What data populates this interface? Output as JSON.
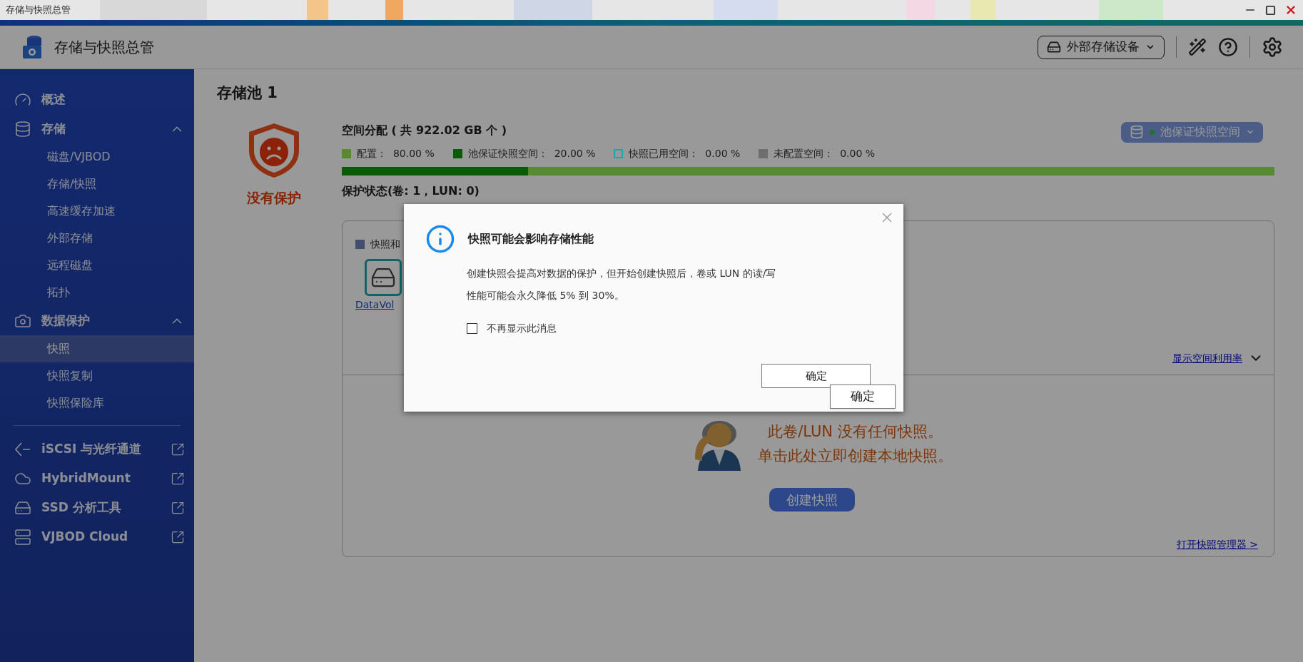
{
  "window": {
    "title": "存储与快照总管"
  },
  "header": {
    "app_title": "存储与快照总管",
    "device_button": "外部存储设备"
  },
  "sidebar": {
    "items": [
      {
        "kind": "link",
        "label": "概述"
      },
      {
        "kind": "group",
        "label": "存储",
        "expanded": true,
        "children": [
          {
            "label": "磁盘/VJBOD",
            "selected": false
          },
          {
            "label": "存储/快照",
            "selected": false
          },
          {
            "label": "高速缓存加速",
            "selected": false
          },
          {
            "label": "外部存储",
            "selected": false
          },
          {
            "label": "远程磁盘",
            "selected": false
          },
          {
            "label": "拓扑",
            "selected": false
          }
        ]
      },
      {
        "kind": "group",
        "label": "数据保护",
        "expanded": true,
        "children": [
          {
            "label": "快照",
            "selected": true
          },
          {
            "label": "快照复制",
            "selected": false
          },
          {
            "label": "快照保险库",
            "selected": false
          }
        ]
      },
      {
        "kind": "external",
        "label": "iSCSI 与光纤通道"
      },
      {
        "kind": "external",
        "label": "HybridMount"
      },
      {
        "kind": "external",
        "label": "SSD 分析工具"
      },
      {
        "kind": "external",
        "label": "VJBOD Cloud"
      }
    ]
  },
  "pool": {
    "title": "存储池 1",
    "status": "没有保护",
    "space": {
      "title": "空间分配 ( 共 922.02 GB 个 )",
      "legend": [
        {
          "label": "配置：  80.00 %",
          "color": "#5a8a2e",
          "kind": "filled"
        },
        {
          "label": "池保证快照空间：  20.00 %",
          "color": "#0a5a0a",
          "kind": "filled"
        },
        {
          "label": "快照已用空间：  0.00 %",
          "color": "#18a8b0",
          "kind": "outline"
        },
        {
          "label": "未配置空间：  0.00 %",
          "color": "#6e6e6e",
          "kind": "filled"
        }
      ],
      "bar": [
        {
          "color": "#0a5a0a",
          "level": 0.2
        },
        {
          "color": "#5a8a2e",
          "level": 0.8
        }
      ]
    },
    "pool_button": "池保证快照空间",
    "protection_title": "保护状态(卷: 1，LUN: 0)",
    "panel": {
      "legend": "快照和",
      "volume": "DataVol",
      "usage_link": "显示空间利用率",
      "empty_lines": [
        "此卷/LUN 没有任何快照。",
        "单击此处立即创建本地快照。"
      ],
      "create_button": "创建快照",
      "manager_link": "打开快照管理器 >"
    }
  },
  "dialog": {
    "title": "快照可能会影响存储性能",
    "body": [
      "创建快照会提高对数据的保护，但开始创建快照后，卷或 LUN 的读/写",
      "性能可能会永久降低 5% 到 30%。"
    ],
    "checkbox": {
      "label": "不再显示此消息",
      "checked": false
    },
    "buttons": [
      "确定",
      "确定"
    ]
  }
}
